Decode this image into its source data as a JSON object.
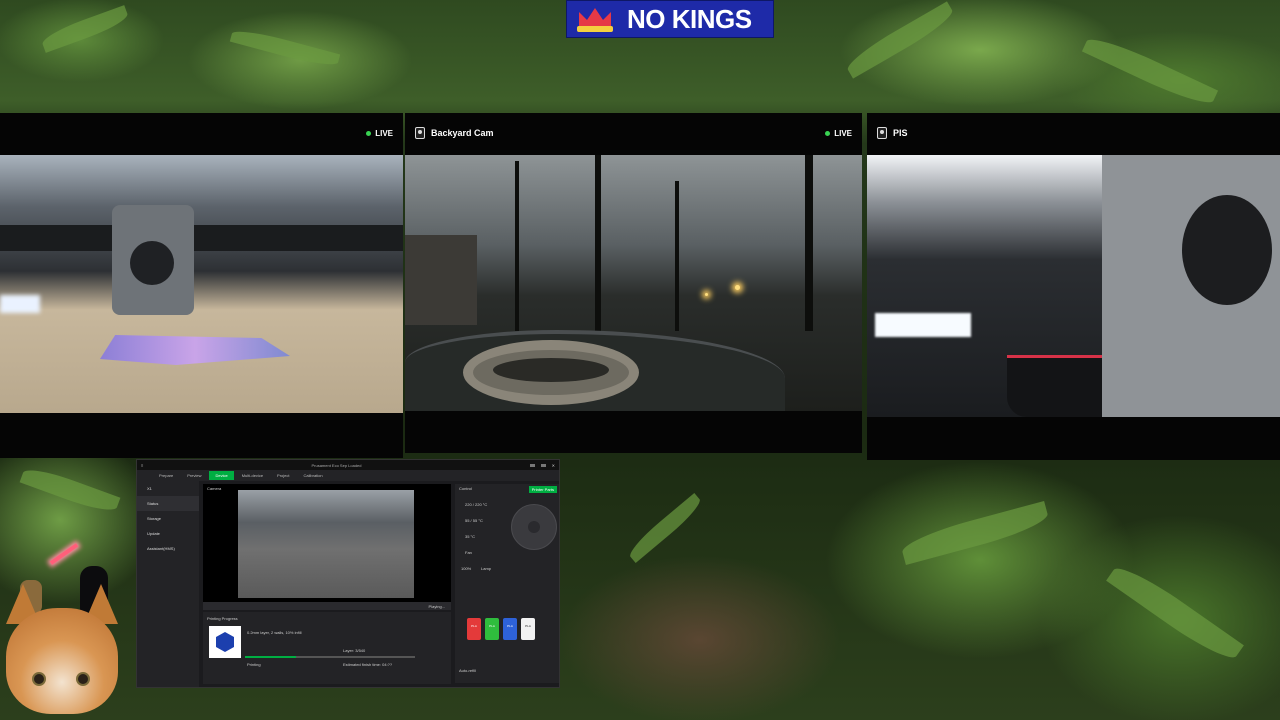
{
  "banner": {
    "text": "NO KINGS",
    "icon": "crown-icon"
  },
  "feeds": [
    {
      "title": "",
      "live_label": "LIVE",
      "icon": ""
    },
    {
      "title": "Backyard Cam",
      "live_label": "LIVE",
      "icon": "camera-icon"
    },
    {
      "title": "PIS",
      "live_label": "",
      "icon": "camera-icon"
    }
  ],
  "bambu": {
    "window_title": "Prusament Eco Sep Loaded",
    "tabs": [
      "Prepare",
      "Preview",
      "Device",
      "Multi-device",
      "Project",
      "Calibration"
    ],
    "active_tab": "Device",
    "sidebar": [
      {
        "label": "X1"
      },
      {
        "label": "Status"
      },
      {
        "label": "Storage"
      },
      {
        "label": "Update"
      },
      {
        "label": "Assistant(HMS)"
      }
    ],
    "camera_label": "Camera",
    "playing_label": "Playing...",
    "progress_header": "Printing Progress",
    "job_name": "0.2mm layer, 2 walls, 10% infill",
    "status": "Printing",
    "layer_text": "Layer: 3/540",
    "time_text": "Estimated finish time: 04:??",
    "progress": 0.3,
    "control_label": "Control",
    "printer_parts_label": "Printer Parts",
    "temps": [
      "220 / 220 °C",
      "55 / 55 °C",
      "35 °C"
    ],
    "fan_label": "Fan",
    "lamp_label": "Lamp",
    "fan_value": "100%",
    "ams_slots": [
      {
        "label": "PLA",
        "color": "#e43a3a"
      },
      {
        "label": "PLA",
        "color": "#2fbd3d"
      },
      {
        "label": "PLA",
        "color": "#2e62d9"
      },
      {
        "label": "PLA",
        "color": "#f2f2f2"
      }
    ],
    "ams_setting": "Auto-refill"
  },
  "colors": {
    "accent": "#00ae42",
    "banner_bg": "#1e2aa8",
    "live_dot": "#39d353"
  }
}
